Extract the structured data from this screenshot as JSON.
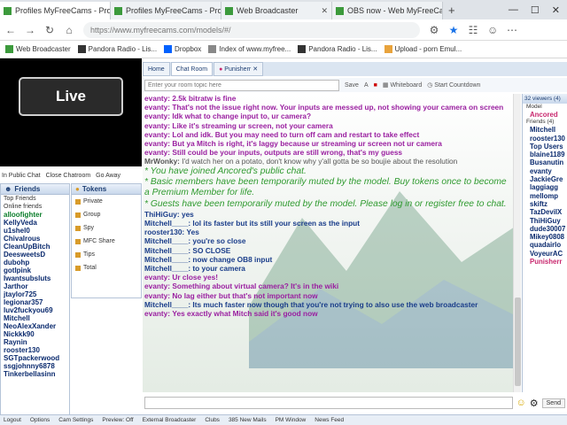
{
  "browser": {
    "tabs": [
      {
        "label": "Profiles MyFreeCams - Profile for",
        "active": true
      },
      {
        "label": "Profiles MyFreeCams - Profile for",
        "active": false
      },
      {
        "label": "Web Broadcaster",
        "active": false
      },
      {
        "label": "OBS now - Web MyFreeCams.c...",
        "active": false
      }
    ],
    "url": "https://www.myfreecams.com/models/#/",
    "bookmarks": [
      "Web Broadcaster",
      "Pandora Radio - Lis...",
      "Dropbox",
      "Index of www.myfree...",
      "Pandora Radio - Lis...",
      "Upload - porn Emul..."
    ]
  },
  "video": {
    "live_label": "Live"
  },
  "leftbar": {
    "items": [
      "In Public Chat",
      "Close Chatroom",
      "Go Away"
    ]
  },
  "friends": {
    "title": "Friends",
    "groups": [
      "Top Friends",
      "Online friends"
    ],
    "items": [
      "alloofighter",
      "KellyVeda",
      "u1shel0",
      "Chivalrous",
      "CleanUpBitch",
      "DeesweetsD",
      "dubohp",
      "gotlpink",
      "Iwantsubsluts",
      "Jarthor",
      "jtaylor725",
      "legionar357",
      "luv2fuckyou69",
      "Mitchell",
      "NeoAlexXander",
      "Nickkk90",
      "Raynin",
      "rooster130",
      "SGTpackerwood",
      "ssgjohnny6878",
      "Tinkerbellasinn"
    ]
  },
  "tokens": {
    "title": "Tokens",
    "items": [
      "Private",
      "Group",
      "Spy",
      "MFC Share",
      "Tips",
      "Total"
    ]
  },
  "chat": {
    "tabs": [
      "Home",
      "Chat Room",
      "Punisherr"
    ],
    "top_input_placeholder": "Enter your room topic here",
    "top_buttons": [
      "Save",
      "Whiteboard",
      "Start Countdown"
    ],
    "messages": [
      {
        "kind": "user",
        "name": "evanty:",
        "text": "2.5k bitratw is fine",
        "color": "pur"
      },
      {
        "kind": "user",
        "name": "evanty:",
        "text": "That's not the issue right now. Your inputs are messed up, not showing your camera on screen",
        "color": "pur"
      },
      {
        "kind": "user",
        "name": "evanty:",
        "text": "Idk what to change input to, ur camera?",
        "color": "pur"
      },
      {
        "kind": "user",
        "name": "evanty:",
        "text": "Like it's streaming ur screen, not your camera",
        "color": "pur"
      },
      {
        "kind": "user",
        "name": "evanty:",
        "text": "Lol and idk. But you may need to turn off cam and restart to take effect",
        "color": "pur"
      },
      {
        "kind": "user",
        "name": "evanty:",
        "text": "But ya Mitch is right, it's laggy because ur streaming ur screen not ur camera",
        "color": "pur"
      },
      {
        "kind": "user",
        "name": "evanty:",
        "text": "Still could be your inputs, outputs are still wrong, that's my guess",
        "color": "pur"
      },
      {
        "kind": "user",
        "name": "MrWonky:",
        "text": "I'd watch her on a potato, don't know why y'all gotta be so boujie about the resolution",
        "color": "gry"
      },
      {
        "kind": "sys",
        "text": "* You have joined Ancored's public chat."
      },
      {
        "kind": "sys",
        "text": "* Basic members have been temporarily muted by the model. Buy tokens once to become a Premium Member for life."
      },
      {
        "kind": "sys",
        "text": "* Guests have been temporarily muted by the model. Please log in or register free to chat."
      },
      {
        "kind": "user",
        "name": "ThiHiGuy:",
        "text": "yes",
        "color": "blu"
      },
      {
        "kind": "user",
        "name": "Mitchell____:",
        "text": "lol its faster but its still your screen as the input",
        "color": "blu"
      },
      {
        "kind": "user",
        "name": "rooster130:",
        "text": "Yes",
        "color": "blu"
      },
      {
        "kind": "user",
        "name": "Mitchell____:",
        "text": "you're so close",
        "color": "blu"
      },
      {
        "kind": "user",
        "name": "Mitchell____:",
        "text": "SO CLOSE",
        "color": "blu"
      },
      {
        "kind": "user",
        "name": "Mitchell____:",
        "text": "now change OB8 input",
        "color": "blu"
      },
      {
        "kind": "user",
        "name": "Mitchell____:",
        "text": "to your camera",
        "color": "blu"
      },
      {
        "kind": "user",
        "name": "evanty:",
        "text": "Ur close yes!",
        "color": "pur"
      },
      {
        "kind": "user",
        "name": "evanty:",
        "text": "Something about virtual camera? It's in the wiki",
        "color": "pur"
      },
      {
        "kind": "user",
        "name": "evanty:",
        "text": "No lag either but that's not important now",
        "color": "pur"
      },
      {
        "kind": "user",
        "name": "Mitchell____:",
        "text": "Its much faster now though that you're not trying to also use the web broadcaster",
        "color": "blu"
      },
      {
        "kind": "user",
        "name": "evanty:",
        "text": "Yes exactly what Mitch said it's good now",
        "color": "pur"
      }
    ],
    "send_label": "Send"
  },
  "viewers": {
    "title": "32 viewers (4)",
    "model_label": "Model",
    "model": "Ancored",
    "friends_label": "Friends (4)",
    "items": [
      "Mitchell",
      "rooster130",
      "Top Users",
      "blaine1189",
      "Busanutin",
      "evanty",
      "JackieGre",
      "laggiagg",
      "mellomp",
      "skiftz",
      "TazDevilX",
      "ThiHiGuy",
      "dude30007",
      "Mikey0808",
      "quadairlo",
      "VoyeurAC"
    ],
    "bottom": "Punisherr"
  },
  "footer": {
    "items": [
      "Logout",
      "Options",
      "Cam Settings",
      "Preview: Off",
      "External Broadcaster",
      "Clubs",
      "385 New Mails",
      "PM Window",
      "News Feed"
    ]
  }
}
